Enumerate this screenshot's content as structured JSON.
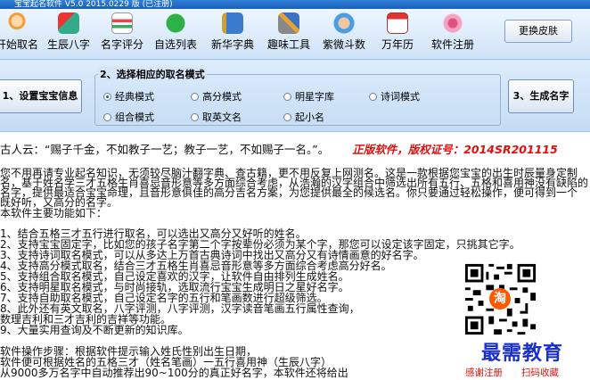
{
  "titlebar": {
    "title": "宝宝起名软件 V5.0 2015.0229 版 (已注册)"
  },
  "toolbar": {
    "items": [
      {
        "label": "开始取名",
        "icon": "baby-icon"
      },
      {
        "label": "生辰八字",
        "icon": "horoscope-icon"
      },
      {
        "label": "名字评分",
        "icon": "score-icon"
      },
      {
        "label": "自选列表",
        "icon": "list-icon"
      },
      {
        "label": "新华字典",
        "icon": "dictionary-icon"
      },
      {
        "label": "趣味工具",
        "icon": "tools-icon"
      },
      {
        "label": "紫微斗数",
        "icon": "fortune-icon"
      },
      {
        "label": "万年历",
        "icon": "calendar-icon"
      },
      {
        "label": "软件注册",
        "icon": "register-icon"
      }
    ],
    "skin_label": "更换皮肤"
  },
  "modes": {
    "set_info_label": "1、设置宝宝信息",
    "group_title": "2、选择相应的取名模式",
    "generate_label": "3、生成名字",
    "options": [
      {
        "label": "经典模式",
        "checked": true
      },
      {
        "label": "高分模式",
        "checked": false
      },
      {
        "label": "明星字库",
        "checked": false
      },
      {
        "label": "诗词模式",
        "checked": false
      },
      {
        "label": "组合模式",
        "checked": false
      },
      {
        "label": "取英文名",
        "checked": false
      },
      {
        "label": "起小名",
        "checked": false
      }
    ]
  },
  "content": {
    "quote": "古人云：“赐子千金，不如教子一艺；教子一艺，不如赐子一名。”。",
    "license": "正版软件，版权证号：2014SR201115",
    "intro": [
      "您不用再请专业起名知识，无须较尽脑汁翻字典、查古籍，更不用反复上网测名。这是一款根据您宝宝的出生时辰量身定制",
      "名，基于姓名学三才五格生肖喜忌音形意等多方面综合考虑，从浩瀚的汉字组合中筛选出所有五行、五格和喜用神没有缺陷的",
      "名字，提供最适合宝宝命理，且音形意俱佳的高分吉名方案，为您提供最全的候选名。你只要通过轻松操作，便可得到一个",
      "既好听，又高分的名字。",
      "本软件主要功能如下："
    ],
    "features": [
      "1、结合五格三才五行进行取名，可以选出又高分又好听的姓名。",
      "2、支持宝宝固定字，比如您的孩子名字第二个字按辈份必须为某个字，那您可以设定该字固定，只挑其它字。",
      "3、支持诗词取名模式，可以从多达上万首古典诗词中找出又高分又有诗情画意的好名字。",
      "4、支持高分模式取名，结合三才五格生肖喜忌音形意等多方面综合考虑高分好名。",
      "5、支持组合取名模式，自己设定喜欢的汉字，让软件自由排列生成姓名。",
      "6、支持明星取名模式，与时尚接轨，选取流行宝宝生成明日之星好名字。",
      "7、支持自助取名模式，自己设定名字的五行和笔画数进行超级筛选。",
      "8、此外还有英文取名，八字评测，八字评测，汉字读音笔画五行属性查询，",
      "    数理吉利和三才吉利的吉祥等功能。",
      "9、大量实用查询及不断更新的知识库。"
    ],
    "steps_title": "软件操作步骤：根据软件提示输入姓氏性别出生日期，",
    "steps": [
      "软件便可根据姓名的五格三才（姓名笔画）一五行喜用神（生辰八字）",
      "从9000多万名字中自动推荐出90~100分的真正好名字，本软件还将给出"
    ],
    "qr_badge": "淘",
    "watermark": "最需教育",
    "footer": {
      "thanks": "感谢注册",
      "scan": "扫码收藏"
    }
  },
  "colors": {
    "accent": "#1a5fb8",
    "license": "#e01010",
    "watermark": "#1a2fc8"
  }
}
